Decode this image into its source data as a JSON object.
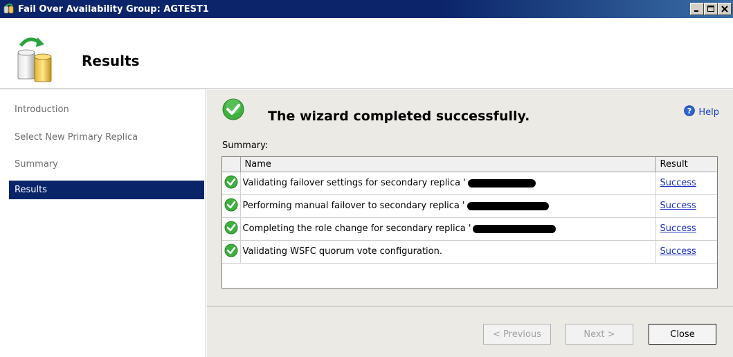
{
  "window": {
    "title": "Fail Over Availability Group: AGTEST1",
    "buttons": [
      "minimize",
      "maximize",
      "close"
    ]
  },
  "header": {
    "title": "Results"
  },
  "nav": {
    "items": [
      {
        "label": "Introduction",
        "active": false
      },
      {
        "label": "Select New Primary Replica",
        "active": false
      },
      {
        "label": "Summary",
        "active": false
      },
      {
        "label": "Results",
        "active": true
      }
    ]
  },
  "main": {
    "banner": "The wizard completed successfully.",
    "help_label": "Help",
    "summary_label": "Summary:",
    "grid": {
      "columns": [
        "Name",
        "Result"
      ],
      "rows": [
        {
          "name": "Validating failover settings for secondary replica '",
          "result": "Success"
        },
        {
          "name": "Performing manual failover to secondary replica '",
          "result": "Success"
        },
        {
          "name": "Completing the role change for secondary replica '",
          "result": "Success"
        },
        {
          "name": "Validating WSFC quorum vote configuration.",
          "result": "Success"
        }
      ]
    }
  },
  "footer": {
    "previous_label": "< Previous",
    "next_label": "Next >",
    "close_label": "Close"
  },
  "colors": {
    "titlebar": "#0b246a",
    "nav_active": "#0a246a",
    "link": "#1a2fc4",
    "success_green": "#3db03d"
  }
}
